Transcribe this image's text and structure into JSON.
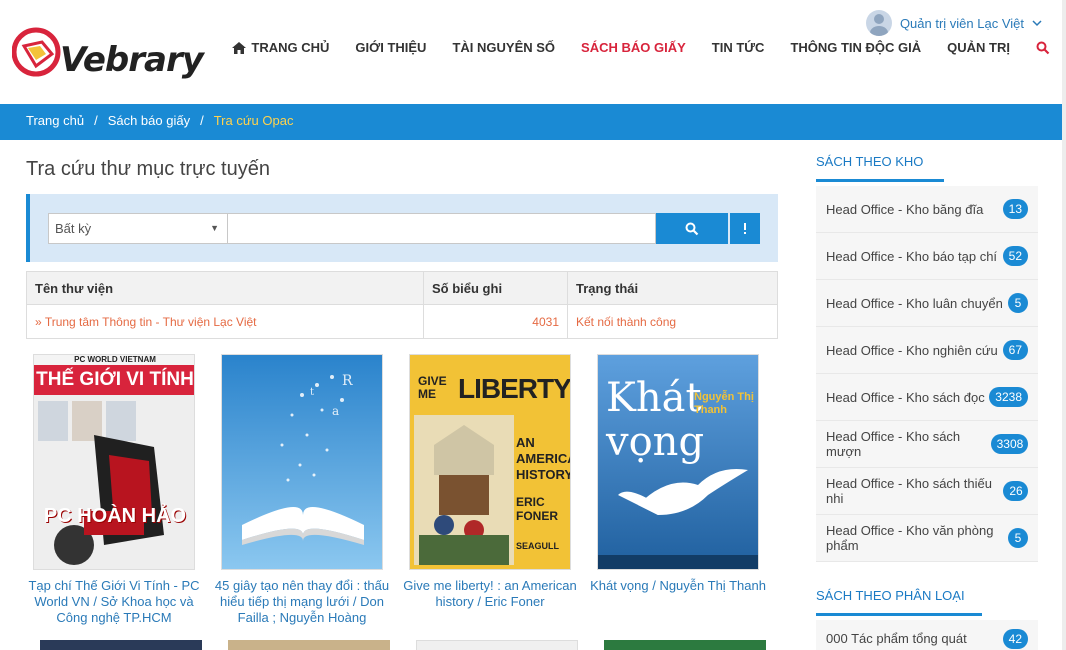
{
  "header": {
    "logo_text": "Vebrary",
    "user_name": "Quản trị viên Lạc Việt",
    "nav": [
      {
        "label": "TRANG CHỦ"
      },
      {
        "label": "GIỚI THIỆU"
      },
      {
        "label": "TÀI NGUYÊN SỐ"
      },
      {
        "label": "SÁCH BÁO GIẤY"
      },
      {
        "label": "TIN TỨC"
      },
      {
        "label": "THÔNG TIN ĐỘC GIẢ"
      },
      {
        "label": "QUẢN TRỊ"
      }
    ],
    "active_color": "#d8243c"
  },
  "breadcrumb": {
    "items": [
      "Trang chủ",
      "Sách báo giấy",
      "Tra cứu Opac"
    ],
    "separator": "/"
  },
  "main": {
    "title": "Tra cứu thư mục trực tuyến",
    "search": {
      "select_value": "Bất kỳ",
      "input_value": ""
    },
    "table": {
      "headers": [
        "Tên thư viện",
        "Số biểu ghi",
        "Trạng thái"
      ],
      "rows": [
        {
          "name": "Trung tâm Thông tin - Thư viện Lạc Việt",
          "count": "4031",
          "status": "Kết nối thành công"
        }
      ]
    },
    "books": [
      {
        "title": "Tạp chí Thế Giới Vi Tính - PC World VN / Sở Khoa học và Công nghệ TP.HCM",
        "cover_top": "PC WORLD VIETNAM",
        "cover_main": "THẾ GIỚI VI TÍNH",
        "cover_sub": "PC HOÀN HẢO"
      },
      {
        "title": "45 giây tạo nên thay đổi : thấu hiểu tiếp thị mạng lưới / Don Failla ; Nguyễn Hoàng",
        "cover_top": "",
        "cover_main": "",
        "cover_sub": ""
      },
      {
        "title": "Give me liberty! : an American history / Eric Foner",
        "cover_top": "GIVE ME",
        "cover_main": "LIBERTY!",
        "cover_sub": "AN AMERICAN HISTORY",
        "cover_author": "ERIC FONER",
        "cover_pub": "SEAGULL"
      },
      {
        "title": "Khát vọng / Nguyễn Thị Thanh",
        "cover_top": "Khát",
        "cover_main": "vọng",
        "cover_sub": "Nguyễn Thị Thanh"
      }
    ]
  },
  "sidebar": {
    "section1": {
      "title": "SÁCH THEO KHO",
      "items": [
        {
          "label": "Head Office - Kho băng đĩa",
          "count": "13"
        },
        {
          "label": "Head Office - Kho báo tạp chí",
          "count": "52"
        },
        {
          "label": "Head Office - Kho luân chuyển",
          "count": "5"
        },
        {
          "label": "Head Office - Kho nghiên cứu",
          "count": "67"
        },
        {
          "label": "Head Office - Kho sách đọc",
          "count": "3238"
        },
        {
          "label": "Head Office - Kho sách mượn",
          "count": "3308"
        },
        {
          "label": "Head Office - Kho sách thiếu nhi",
          "count": "26"
        },
        {
          "label": "Head Office - Kho văn phòng phẩm",
          "count": "5"
        }
      ]
    },
    "section2": {
      "title": "SÁCH THEO PHÂN LOẠI",
      "items": [
        {
          "label": "000 Tác phẩm tổng quát",
          "count": "42"
        }
      ]
    }
  },
  "colors": {
    "brand_blue": "#1a8ad4",
    "link_orange": "#e56a43",
    "link_blue": "#2a7ab8"
  }
}
